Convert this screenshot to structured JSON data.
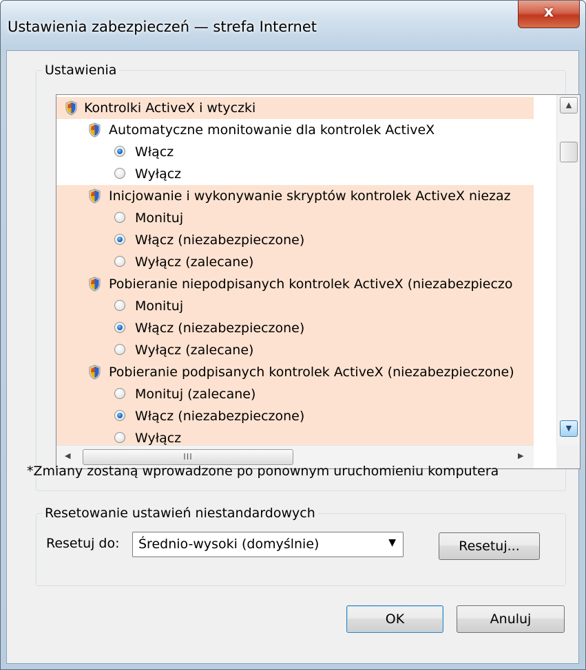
{
  "window": {
    "title": "Ustawienia zabezpieczeń — strefa Internet",
    "close_glyph": "x"
  },
  "settings_group": {
    "label": "Ustawienia",
    "rows": [
      {
        "kind": "category",
        "text": "Kontrolki ActiveX i wtyczki",
        "highlight": true
      },
      {
        "kind": "setting",
        "text": "Automatyczne monitowanie dla kontrolek ActiveX",
        "highlight": false
      },
      {
        "kind": "option",
        "text": "Włącz",
        "checked": true,
        "highlight": false
      },
      {
        "kind": "option",
        "text": "Wyłącz",
        "checked": false,
        "highlight": false
      },
      {
        "kind": "setting",
        "text": "Inicjowanie i wykonywanie skryptów kontrolek ActiveX niezaz",
        "highlight": true
      },
      {
        "kind": "option",
        "text": "Monituj",
        "checked": false,
        "highlight": true
      },
      {
        "kind": "option",
        "text": "Włącz (niezabezpieczone)",
        "checked": true,
        "highlight": true
      },
      {
        "kind": "option",
        "text": "Wyłącz (zalecane)",
        "checked": false,
        "highlight": true
      },
      {
        "kind": "setting",
        "text": "Pobieranie niepodpisanych kontrolek ActiveX (niezabezpieczo",
        "highlight": true
      },
      {
        "kind": "option",
        "text": "Monituj",
        "checked": false,
        "highlight": true
      },
      {
        "kind": "option",
        "text": "Włącz (niezabezpieczone)",
        "checked": true,
        "highlight": true
      },
      {
        "kind": "option",
        "text": "Wyłącz (zalecane)",
        "checked": false,
        "highlight": true
      },
      {
        "kind": "setting",
        "text": "Pobieranie podpisanych kontrolek ActiveX (niezabezpieczone)",
        "highlight": true
      },
      {
        "kind": "option",
        "text": "Monituj (zalecane)",
        "checked": false,
        "highlight": true
      },
      {
        "kind": "option",
        "text": "Włącz (niezabezpieczone)",
        "checked": true,
        "highlight": true
      },
      {
        "kind": "option",
        "text": "Wyłącz",
        "checked": false,
        "highlight": true
      }
    ],
    "scroll": {
      "up": "▲",
      "down": "▼",
      "left": "◀",
      "right": "▶",
      "grip": "III"
    },
    "note": "*Zmiany zostaną wprowadzone po ponownym uruchomieniu komputera"
  },
  "reset_group": {
    "label": "Resetowanie ustawień niestandardowych",
    "reset_to_label": "Resetuj do:",
    "combo_value": "Średnio-wysoki (domyślnie)",
    "combo_arrow": "▼",
    "reset_button": "Resetuj..."
  },
  "buttons": {
    "ok": "OK",
    "cancel": "Anuluj"
  },
  "colors": {
    "highlight_row": "#fde2d1",
    "accent": "#3c7fb1"
  }
}
